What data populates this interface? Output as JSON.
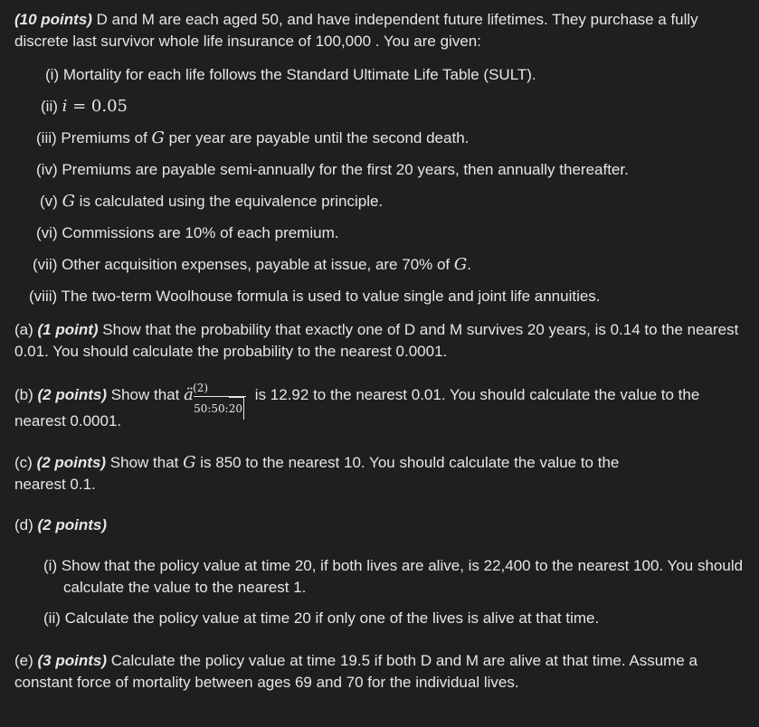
{
  "intro": {
    "points": "(10 points)",
    "text": " D and M are each aged 50, and have independent future lifetimes. They purchase a fully discrete last survivor whole life insurance of 100,000 . You are given:"
  },
  "given": [
    {
      "num": "(i)",
      "pre": "Mortality for each life follows the Standard Ultimate Life Table (SULT).",
      "math": "",
      "post": ""
    },
    {
      "num": "(ii)",
      "pre": "",
      "math": "i",
      "post": " = 0.05"
    },
    {
      "num": "(iii)",
      "pre": "Premiums of ",
      "math": "G",
      "post": " per year are payable until the second death."
    },
    {
      "num": "(iv)",
      "pre": "Premiums are payable semi-annually for the first 20 years, then annually thereafter.",
      "math": "",
      "post": ""
    },
    {
      "num": "(v)",
      "pre": "",
      "math": "G",
      "post": " is calculated using the equivalence principle."
    },
    {
      "num": "(vi)",
      "pre": "Commissions are 10% of each premium.",
      "math": "",
      "post": ""
    },
    {
      "num": "(vii)",
      "pre": "Other acquisition expenses, payable at issue, are 70% of ",
      "math": "G",
      "post": "."
    },
    {
      "num": "(viii)",
      "pre": "The two-term Woolhouse formula is used to value single and joint life annuities.",
      "math": "",
      "post": ""
    }
  ],
  "part_a": {
    "label": "(a)",
    "points": "(1 point)",
    "text": " Show that the probability that exactly one of D and M survives 20 years, is 0.14 to the nearest 0.01. You should calculate the probability to the nearest 0.0001."
  },
  "part_b": {
    "label": "(b)",
    "points": "(2 points)",
    "pre": " Show that ",
    "symbol": "ä",
    "sup": "(2)",
    "sub": "50:50:",
    "sub_term": "20",
    "post": " is 12.92 to the nearest 0.01. You should calculate the value to the",
    "line2": "nearest 0.0001."
  },
  "part_c": {
    "label": "(c)",
    "points": "(2 points)",
    "pre": " Show that ",
    "math": "G",
    "post": " is 850 to the nearest 10. You should calculate the value to the",
    "line2": "nearest 0.1."
  },
  "part_d": {
    "label": "(d)",
    "points": "(2 points)",
    "items": [
      {
        "num": "(i)",
        "text": "Show that the policy value at time 20, if both lives are alive, is 22,400 to the nearest 100. You should calculate the value to the nearest 1."
      },
      {
        "num": "(ii)",
        "text": "Calculate the policy value at time 20 if only one of the lives is alive at that time."
      }
    ]
  },
  "part_e": {
    "label": "(e)",
    "points": "(3 points)",
    "text": " Calculate the policy value at time 19.5 if both D and M are alive at that time. Assume a constant force of mortality between ages 69 and 70 for the individual lives."
  }
}
